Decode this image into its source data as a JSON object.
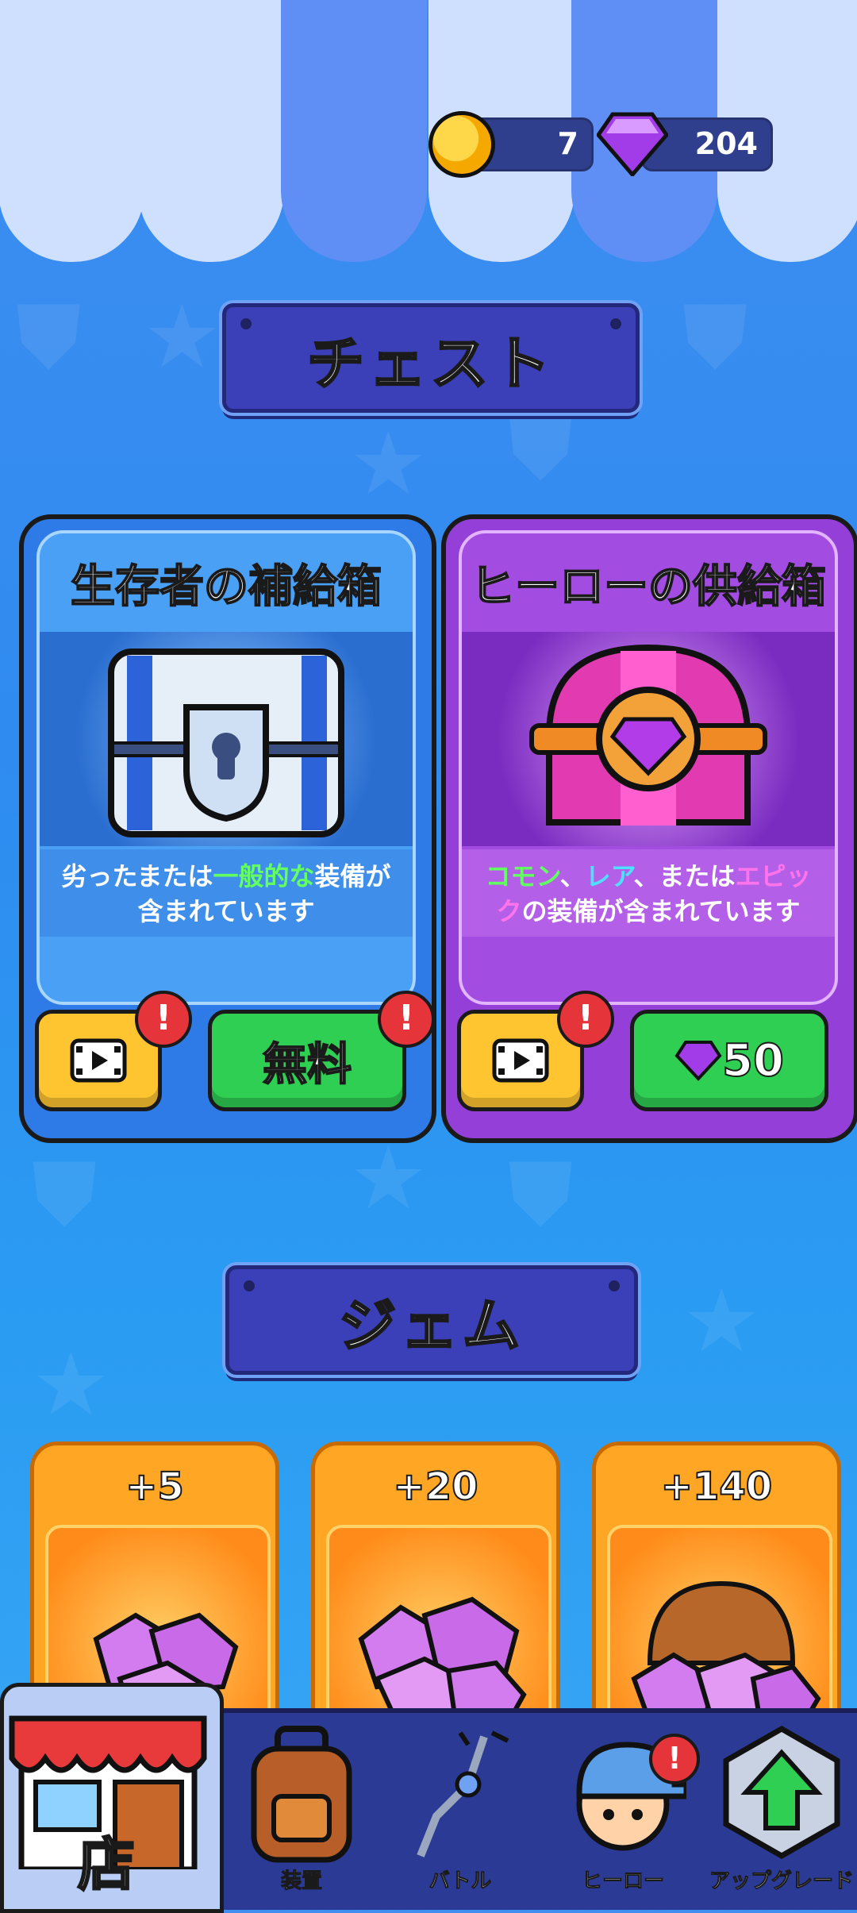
{
  "currency": {
    "coins": "7",
    "gems": "204"
  },
  "sections": {
    "chests_title": "チェスト",
    "gems_title": "ジェム"
  },
  "chests": [
    {
      "title": "生存者の補給箱",
      "desc_line1_a": "劣ったまたは",
      "desc_line1_b": "一般的な",
      "desc_line1_c": "装備が",
      "desc_line2": "含まれています",
      "free_label": "無料",
      "alert_mark": "!"
    },
    {
      "title": "ヒーローの供給箱",
      "desc_line1_a": "コモン",
      "desc_line1_b": "、",
      "desc_line1_c": "レア",
      "desc_line1_d": "、または",
      "desc_line1_e": "エピッ",
      "desc_line2_a": "ク",
      "desc_line2_b": "の装備が含まれています",
      "price": "50",
      "alert_mark": "!"
    }
  ],
  "gem_packs": [
    {
      "amount": "+5"
    },
    {
      "amount": "+20"
    },
    {
      "amount": "+140"
    }
  ],
  "nav": {
    "shop": "店",
    "equipment": "装置",
    "battle": "バトル",
    "hero": "ヒーロー",
    "upgrade": "アップグレード",
    "alert_mark": "!"
  }
}
